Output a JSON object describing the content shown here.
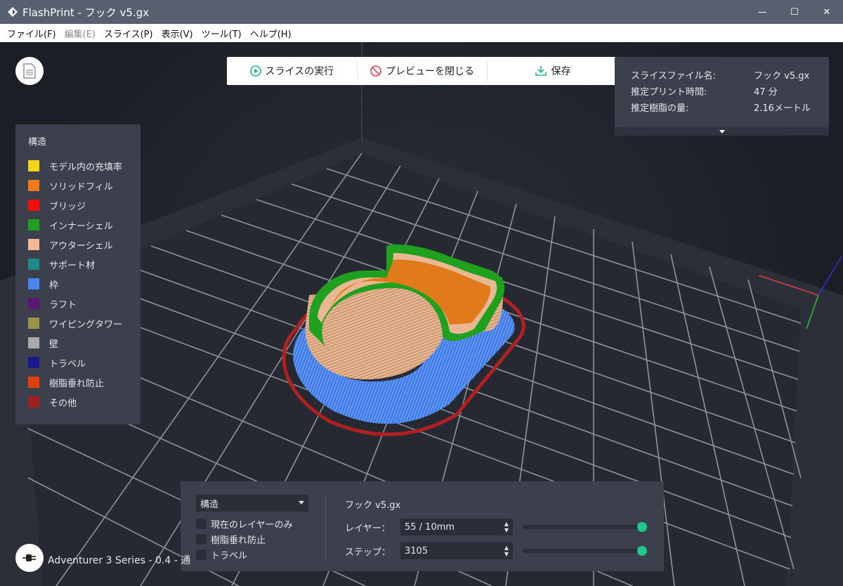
{
  "window": {
    "title": "FlashPrint - フック v5.gx",
    "controls": {
      "minimize": "—",
      "maximize": "☐",
      "close": "✕"
    }
  },
  "menubar": {
    "items": [
      {
        "label": "ファイル(F)",
        "enabled": true
      },
      {
        "label": "編集(E)",
        "enabled": false
      },
      {
        "label": "スライス(P)",
        "enabled": true
      },
      {
        "label": "表示(V)",
        "enabled": true
      },
      {
        "label": "ツール(T)",
        "enabled": true
      },
      {
        "label": "ヘルプ(H)",
        "enabled": true
      }
    ]
  },
  "toolbar": {
    "slice_label": "スライスの実行",
    "close_preview_label": "プレビューを閉じる",
    "save_label": "保存",
    "accent": "#1fb89a",
    "close_color": "#e0405a"
  },
  "info_panel": {
    "rows": [
      {
        "label": "スライスファイル名:",
        "value": "フック v5.gx"
      },
      {
        "label": "推定プリント時間:",
        "value": "47 分"
      },
      {
        "label": "推定樹脂の量:",
        "value": "2.16メートル"
      }
    ]
  },
  "legend": {
    "title": "構造",
    "items": [
      {
        "label": "モデル内の充填率",
        "color": "#f5d316"
      },
      {
        "label": "ソリッドフィル",
        "color": "#f07a1a"
      },
      {
        "label": "ブリッジ",
        "color": "#f01010"
      },
      {
        "label": "インナーシェル",
        "color": "#1fa01f"
      },
      {
        "label": "アウターシェル",
        "color": "#f5b896"
      },
      {
        "label": "サポート材",
        "color": "#1e8a8a"
      },
      {
        "label": "枠",
        "color": "#4a86f0"
      },
      {
        "label": "ラフト",
        "color": "#5a1670"
      },
      {
        "label": "ワイピングタワー",
        "color": "#9a9448"
      },
      {
        "label": "壁",
        "color": "#aaaaaa"
      },
      {
        "label": "トラベル",
        "color": "#1a1a90"
      },
      {
        "label": "樹脂垂れ防止",
        "color": "#e04010"
      },
      {
        "label": "その他",
        "color": "#a02020"
      }
    ]
  },
  "bottom_panel": {
    "view_select": "構造",
    "checkboxes": [
      {
        "label": "現在のレイヤーのみ",
        "checked": false
      },
      {
        "label": "樹脂垂れ防止",
        "checked": false
      },
      {
        "label": "トラベル",
        "checked": false
      }
    ],
    "file_name": "フック v5.gx",
    "layer_label": "レイヤー：",
    "layer_value": "55 / 10mm",
    "layer_level": 1.0,
    "step_label": "ステップ：",
    "step_value": "3105",
    "step_level": 1.0
  },
  "printer": {
    "text": "Adventurer 3 Series - 0.4 - 通"
  }
}
